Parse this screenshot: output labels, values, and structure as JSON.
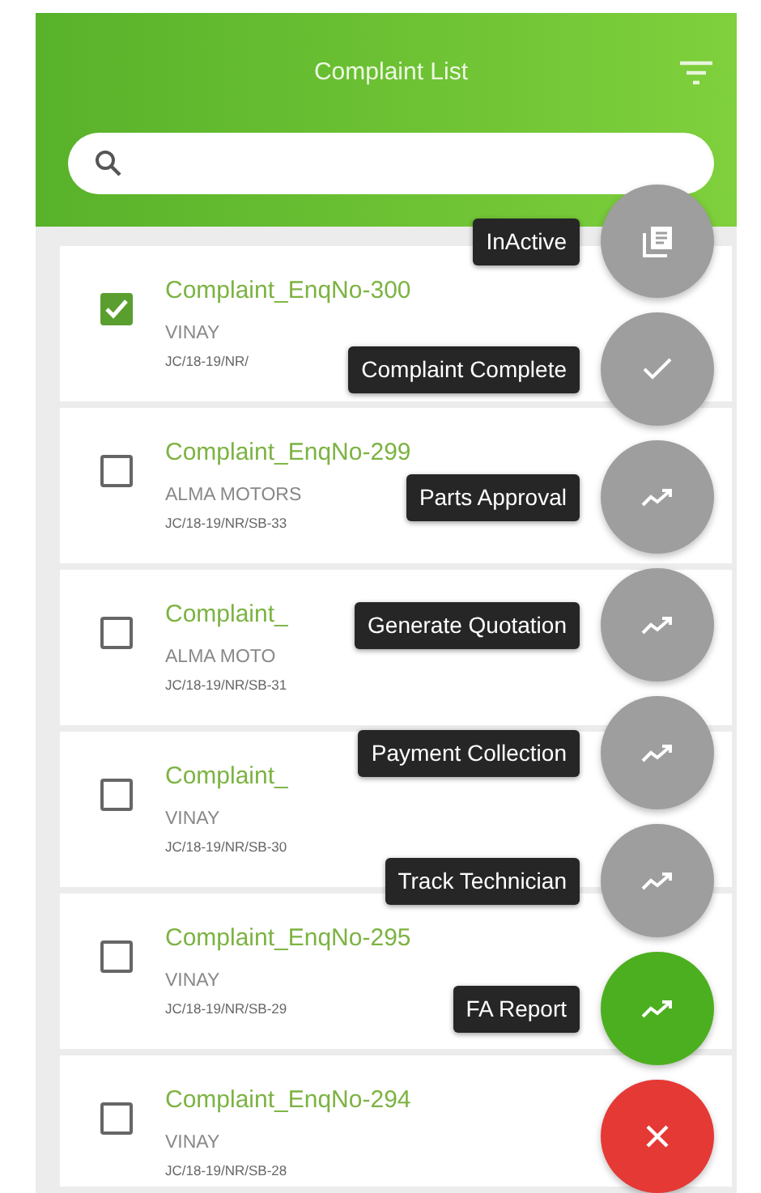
{
  "header": {
    "title": "Complaint List"
  },
  "complaints": [
    {
      "title": "Complaint_EnqNo-300",
      "customer": "VINAY",
      "code": "JC/18-19/NR/",
      "checked": true
    },
    {
      "title": "Complaint_EnqNo-299",
      "customer": "ALMA MOTORS",
      "code": "JC/18-19/NR/SB-33",
      "checked": false
    },
    {
      "title": "Complaint_",
      "customer": "ALMA MOTO",
      "code": "JC/18-19/NR/SB-31",
      "checked": false
    },
    {
      "title": "Complaint_",
      "customer": "VINAY",
      "code": "JC/18-19/NR/SB-30",
      "checked": false
    },
    {
      "title": "Complaint_EnqNo-295",
      "customer": "VINAY",
      "code": "JC/18-19/NR/SB-29",
      "checked": false
    },
    {
      "title": "Complaint_EnqNo-294",
      "customer": "VINAY",
      "code": "JC/18-19/NR/SB-28",
      "checked": false
    }
  ],
  "actions": [
    {
      "label": "InActive",
      "kind": "copy",
      "color": "#9e9e9e"
    },
    {
      "label": "Complaint Complete",
      "kind": "check",
      "color": "#9e9e9e"
    },
    {
      "label": "Parts Approval",
      "kind": "trend",
      "color": "#9e9e9e"
    },
    {
      "label": "Generate Quotation",
      "kind": "trend",
      "color": "#9e9e9e"
    },
    {
      "label": "Payment Collection",
      "kind": "trend",
      "color": "#9e9e9e"
    },
    {
      "label": "Track Technician",
      "kind": "trend",
      "color": "#9e9e9e"
    },
    {
      "label": "FA Report",
      "kind": "trend",
      "color": "#4caf1f"
    },
    {
      "kind": "close",
      "color": "#e53935"
    }
  ]
}
